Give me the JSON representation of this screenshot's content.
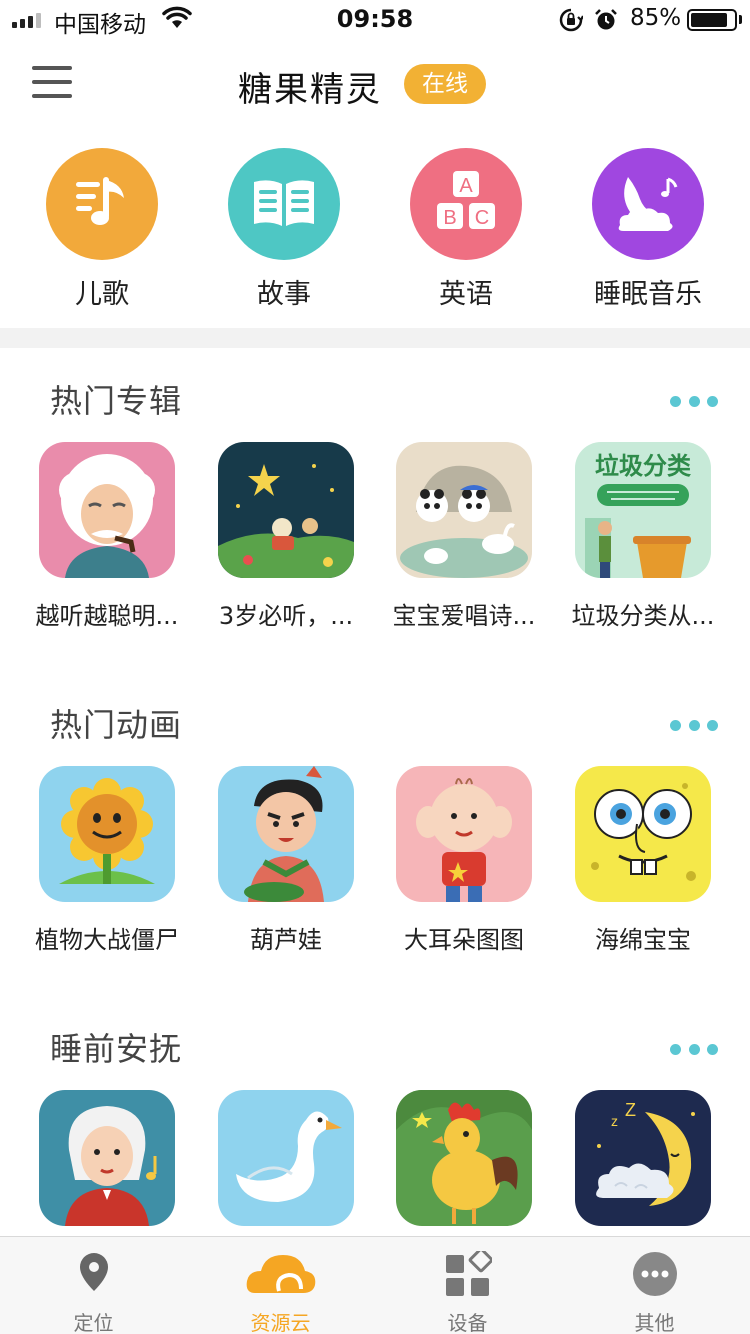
{
  "status_bar": {
    "carrier": "中国移动",
    "time": "09:58",
    "battery_percent": "85%",
    "battery_level": 0.85,
    "icons": [
      "signal-icon",
      "wifi-icon",
      "rotation-lock-icon",
      "alarm-icon",
      "battery-icon"
    ]
  },
  "header": {
    "menu_icon": "hamburger-menu-icon",
    "title": "糖果精灵",
    "status_badge": "在线",
    "badge_color": "#f2b134"
  },
  "categories": [
    {
      "label": "儿歌",
      "icon": "music-note-icon",
      "color": "#f2a93b"
    },
    {
      "label": "故事",
      "icon": "open-book-icon",
      "color": "#4ec7c4"
    },
    {
      "label": "英语",
      "icon": "abc-blocks-icon",
      "color": "#ef6f82"
    },
    {
      "label": "睡眠音乐",
      "icon": "moon-cloud-icon",
      "color": "#a047e0"
    }
  ],
  "sections": [
    {
      "title": "热门专辑",
      "more_icon": "more-dots-icon",
      "items": [
        {
          "label": "越听越聪明...",
          "thumb": "einstein-thumb"
        },
        {
          "label": "3岁必听，...",
          "thumb": "night-meadow-thumb"
        },
        {
          "label": "宝宝爱唱诗...",
          "thumb": "panda-geese-thumb"
        },
        {
          "label": "垃圾分类从...",
          "thumb": "garbage-sorting-thumb",
          "thumb_text": "垃圾分类"
        }
      ]
    },
    {
      "title": "热门动画",
      "more_icon": "more-dots-icon",
      "items": [
        {
          "label": "植物大战僵尸",
          "thumb": "sunflower-thumb"
        },
        {
          "label": "葫芦娃",
          "thumb": "calabash-brother-thumb"
        },
        {
          "label": "大耳朵图图",
          "thumb": "big-ear-tutu-thumb"
        },
        {
          "label": "海绵宝宝",
          "thumb": "spongebob-thumb"
        }
      ]
    },
    {
      "title": "睡前安抚",
      "more_icon": "more-dots-icon",
      "items": [
        {
          "label": "",
          "thumb": "mozart-thumb"
        },
        {
          "label": "",
          "thumb": "swan-thumb"
        },
        {
          "label": "",
          "thumb": "rooster-thumb"
        },
        {
          "label": "",
          "thumb": "sleepy-moon-thumb"
        }
      ]
    }
  ],
  "tabbar": [
    {
      "label": "定位",
      "icon": "location-pin-icon",
      "active": false
    },
    {
      "label": "资源云",
      "icon": "cloud-icon",
      "active": true
    },
    {
      "label": "设备",
      "icon": "device-grid-icon",
      "active": false
    },
    {
      "label": "其他",
      "icon": "more-circle-icon",
      "active": false
    }
  ],
  "colors": {
    "accent": "#f5a623",
    "more_dots": "#5bc7d3",
    "tab_inactive": "#777777"
  }
}
